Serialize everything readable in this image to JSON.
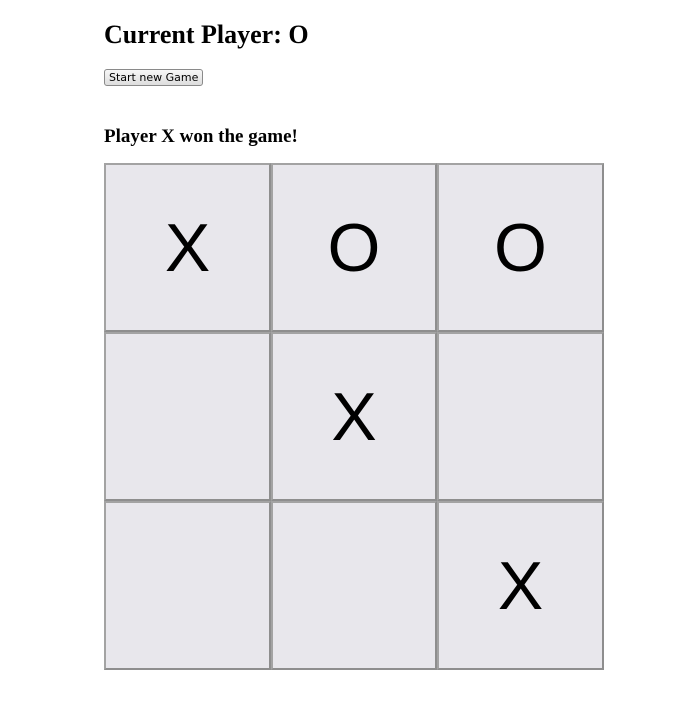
{
  "header": {
    "current_player_text": "Current Player: O"
  },
  "controls": {
    "new_game_label": "Start new Game"
  },
  "status": {
    "message": "Player X won the game!"
  },
  "board": {
    "cells": [
      "X",
      "O",
      "O",
      "",
      "X",
      "",
      "",
      "",
      "X"
    ]
  }
}
